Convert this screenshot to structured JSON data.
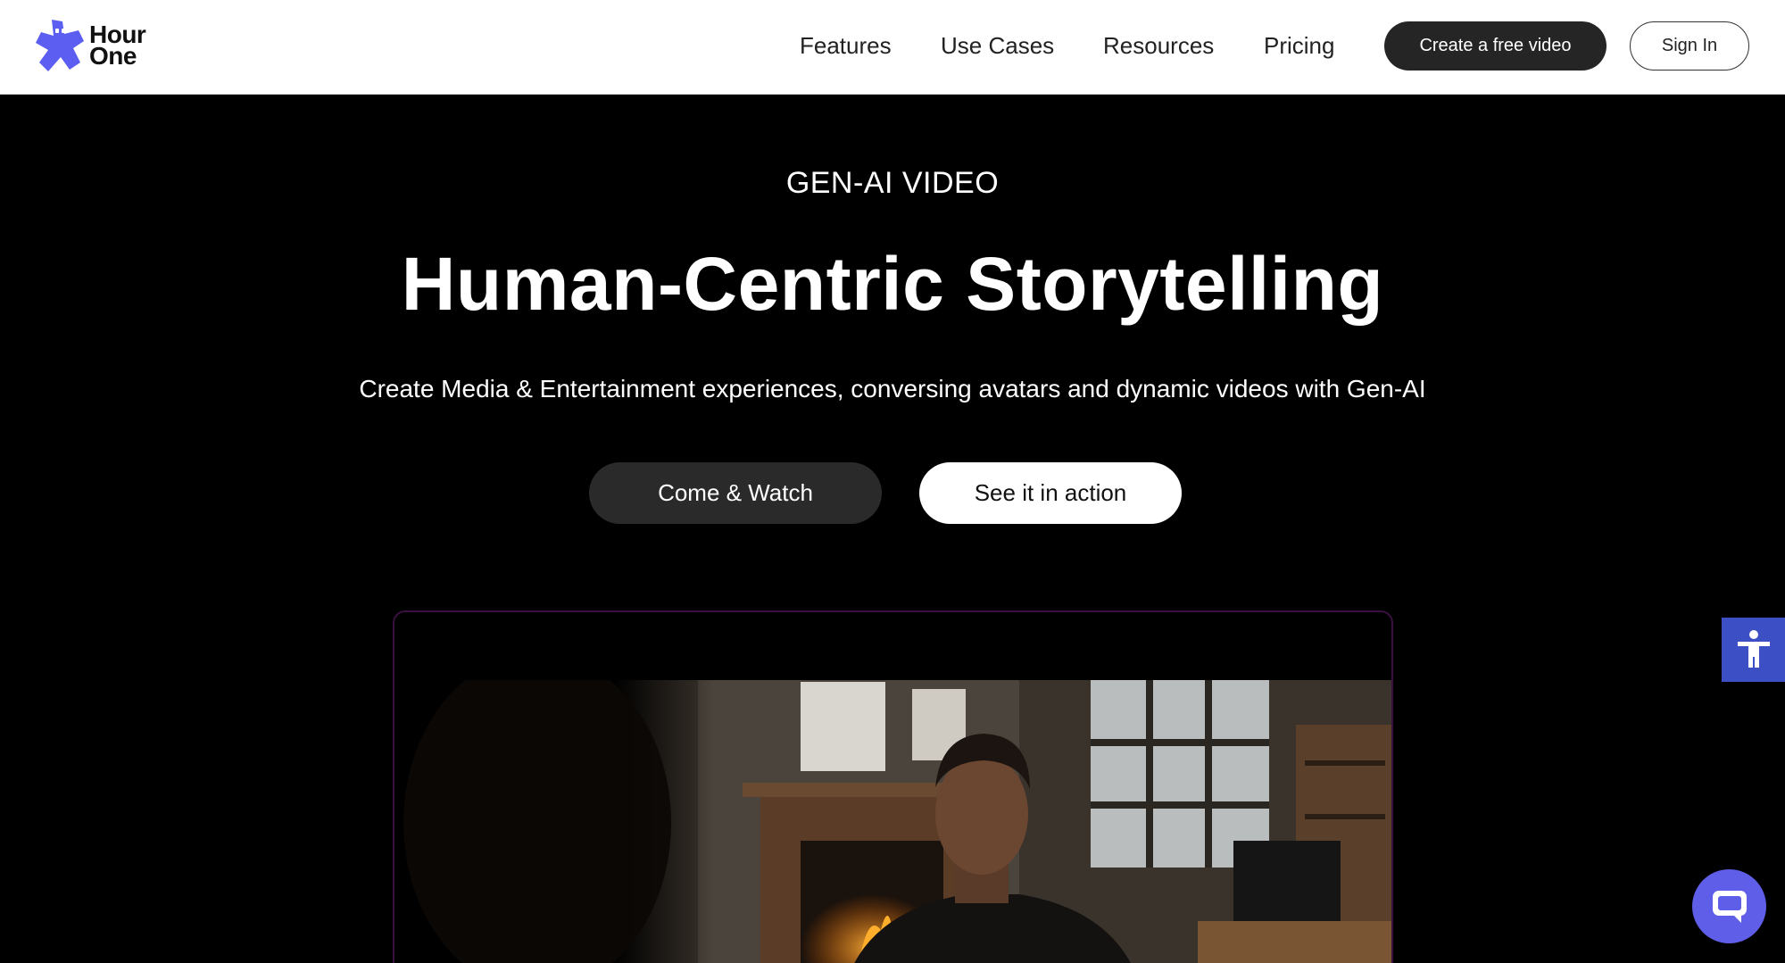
{
  "brand": {
    "logo_line1": "Hour",
    "logo_line2": "One",
    "accent": "#5b5ef0"
  },
  "nav": {
    "items": [
      {
        "label": "Features"
      },
      {
        "label": "Use Cases"
      },
      {
        "label": "Resources"
      },
      {
        "label": "Pricing"
      }
    ],
    "create_label": "Create a free video",
    "signin_label": "Sign In"
  },
  "hero": {
    "eyebrow": "GEN-AI VIDEO",
    "title": "Human-Centric Storytelling",
    "subtitle": "Create Media & Entertainment experiences, conversing avatars and dynamic videos with Gen-AI",
    "primary_label": "Come & Watch",
    "secondary_label": "See it in action"
  },
  "widgets": {
    "accessibility_icon": "accessibility-icon",
    "chat_icon": "chat-bubble-icon",
    "accessibility_color": "#3d4fc4",
    "chat_color": "#5f5ee8"
  }
}
